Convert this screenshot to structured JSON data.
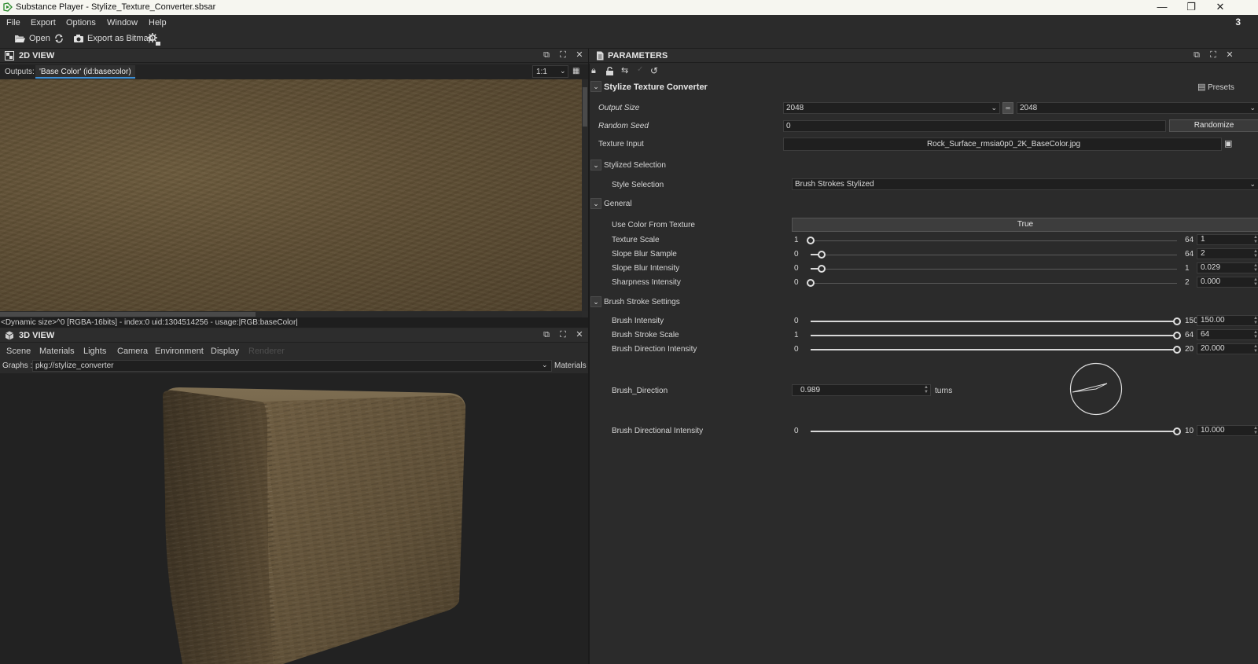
{
  "window": {
    "title": "Substance Player - Stylize_Texture_Converter.sbsar",
    "controls": [
      "—",
      "❐",
      "✕"
    ]
  },
  "menu": {
    "items": [
      "File",
      "Export",
      "Options",
      "Window",
      "Help"
    ],
    "badge": "3"
  },
  "toolbar": {
    "open_label": "Open",
    "export_label": "Export as Bitmap"
  },
  "view2d": {
    "title": "2D VIEW",
    "outputs_label": "Outputs:",
    "output_tab": "'Base Color' (id:basecolor)",
    "zoom": "1:1",
    "status": "<Dynamic size>^0 [RGBA-16bits] - index:0 uid:1304514256 - usage:|RGB:baseColor|"
  },
  "view3d": {
    "title": "3D VIEW",
    "tabs": [
      "Scene",
      "Materials",
      "Lights",
      "Camera",
      "Environment",
      "Display",
      "Renderer"
    ],
    "graphs_label": "Graphs :",
    "graph_value": "pkg://stylize_converter",
    "materials_label": "Materials"
  },
  "parameters": {
    "title": "PARAMETERS",
    "group_title": "Stylize Texture Converter",
    "presets_label": "Presets",
    "output_size": {
      "label": "Output Size",
      "width": "2048",
      "height": "2048"
    },
    "random_seed": {
      "label": "Random Seed",
      "value": "0",
      "button": "Randomize"
    },
    "texture_input": {
      "label": "Texture Input",
      "value": "Rock_Surface_rmsia0p0_2K_BaseColor.jpg"
    },
    "stylized_selection": {
      "group": "Stylized Selection",
      "label": "Style Selection",
      "value": "Brush Strokes Stylized"
    },
    "general": {
      "group": "General",
      "use_color_label": "Use Color From Texture",
      "use_color_value": "True",
      "sliders": [
        {
          "label": "Texture Scale",
          "min": "1",
          "max": "64",
          "value": "1",
          "fraction": 0.0
        },
        {
          "label": "Slope Blur Sample",
          "min": "0",
          "max": "64",
          "value": "2",
          "fraction": 0.031
        },
        {
          "label": "Slope Blur Intensity",
          "min": "0",
          "max": "1",
          "value": "0.029",
          "fraction": 0.029
        },
        {
          "label": "Sharpness Intensity",
          "min": "0",
          "max": "2",
          "value": "0.000",
          "fraction": 0.0
        }
      ]
    },
    "brush": {
      "group": "Brush Stroke Settings",
      "sliders": [
        {
          "label": "Brush Intensity",
          "min": "0",
          "max": "150",
          "value": "150.00",
          "fraction": 1.0
        },
        {
          "label": "Brush Stroke Scale",
          "min": "1",
          "max": "64",
          "value": "64",
          "fraction": 1.0
        },
        {
          "label": "Brush Direction Intensity",
          "min": "0",
          "max": "20",
          "value": "20.000",
          "fraction": 1.0
        }
      ],
      "direction": {
        "label": "Brush_Direction",
        "value": "0.989",
        "unit": "turns"
      },
      "directional": {
        "label": "Brush Directional Intensity",
        "min": "0",
        "max": "10",
        "value": "10.000",
        "fraction": 1.0
      }
    }
  }
}
